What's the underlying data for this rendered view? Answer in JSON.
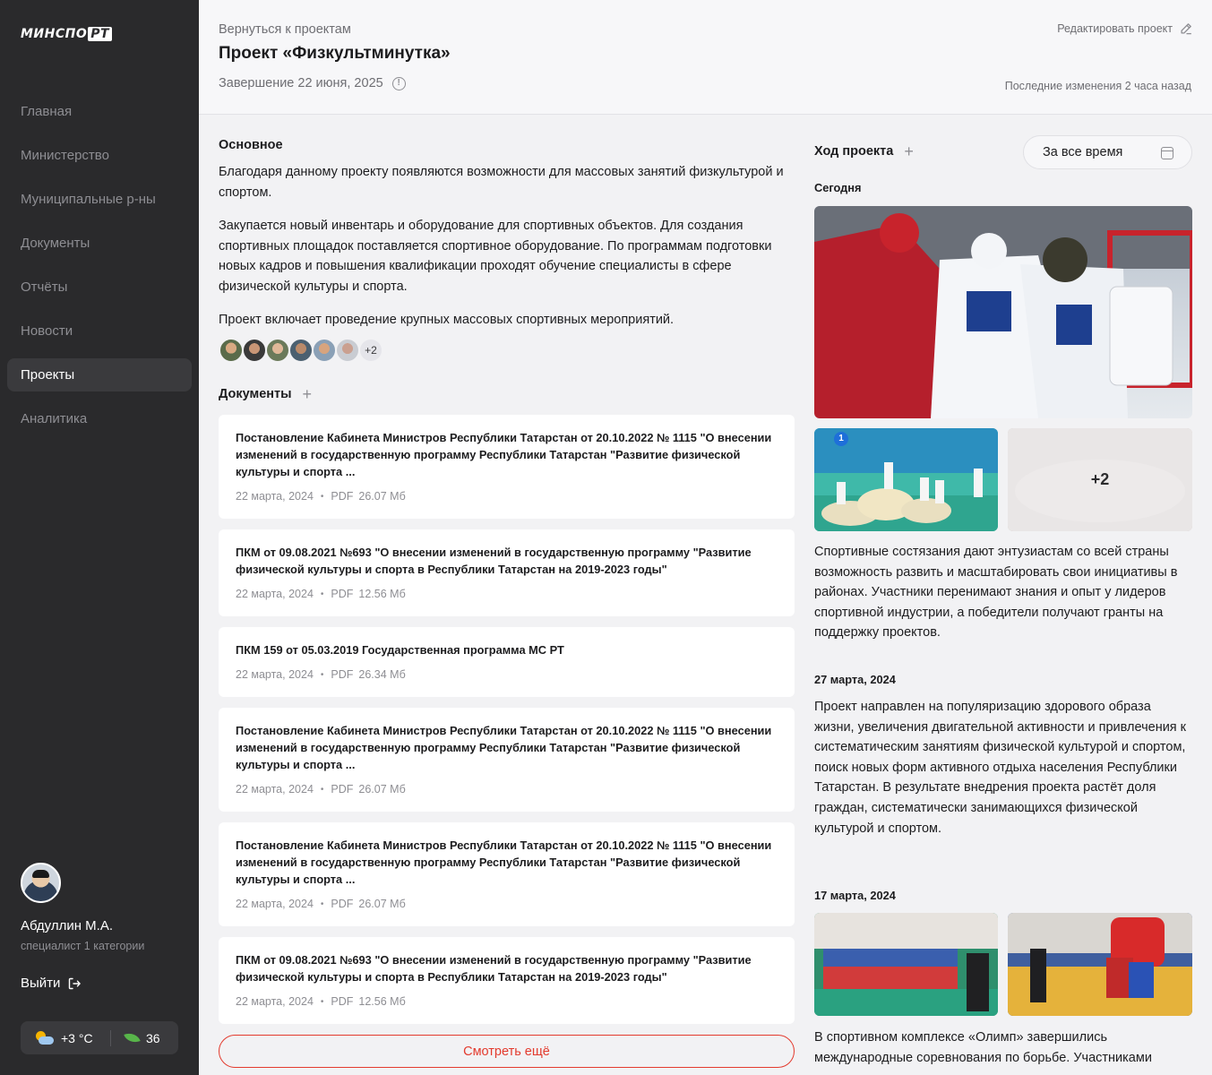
{
  "sidebar": {
    "logo": {
      "left": "МИНСПО",
      "boxed": "РТ"
    },
    "nav": [
      {
        "label": "Главная",
        "active": false
      },
      {
        "label": "Министерство",
        "active": false
      },
      {
        "label": "Муниципальные р-ны",
        "active": false
      },
      {
        "label": "Документы",
        "active": false
      },
      {
        "label": "Отчёты",
        "active": false
      },
      {
        "label": "Новости",
        "active": false
      },
      {
        "label": "Проекты",
        "active": true
      },
      {
        "label": "Аналитика",
        "active": false
      }
    ],
    "user": {
      "name": "Абдуллин М.А.",
      "role": "специалист 1 категории",
      "logout": "Выйти"
    },
    "widget": {
      "temperature": "+3 °C",
      "eco_value": "36"
    }
  },
  "header": {
    "back_link": "Вернуться к проектам",
    "title": "Проект «Физкультминутка»",
    "deadline": "Завершение 22 июня, 2025",
    "edit_link": "Редактировать проект",
    "last_change": "Последние изменения 2 часа назад"
  },
  "main": {
    "overview_heading": "Основное",
    "paragraphs": [
      "Благодаря данному проекту появляются возможности для массовых занятий физкультурой и спортом.",
      "Закупается новый инвентарь и оборудование для спортивных объектов. Для создания спортивных площадок поставляется спортивное оборудование. По программам подготовки новых кадров и повышения квалификации проходят обучение специалисты в сфере физической культуры и спорта.",
      "Проект включает проведение крупных массовых спортивных мероприятий."
    ],
    "participants_more": "+2",
    "documents_heading": "Документы",
    "documents": [
      {
        "title": "Постановление Кабинета Министров Республики Татарстан от 20.10.2022 № 1115 \"О внесении изменений в государственную программу Республики Татарстан \"Развитие физической культуры и спорта ...",
        "date": "22 марта, 2024",
        "type": "PDF",
        "size": "26.07 Мб"
      },
      {
        "title": "ПКМ от 09.08.2021 №693 \"О внесении изменений в государственную программу \"Развитие физической культуры и спорта в Республики Татарстан на 2019-2023 годы\"",
        "date": "22 марта, 2024",
        "type": "PDF",
        "size": "12.56 Мб"
      },
      {
        "title": "ПКМ 159 от 05.03.2019 Государственная программа МС РТ",
        "date": "22 марта, 2024",
        "type": "PDF",
        "size": "26.34 Мб"
      },
      {
        "title": "Постановление Кабинета Министров Республики Татарстан от 20.10.2022 № 1115 \"О внесении изменений в государственную программу Республики Татарстан \"Развитие физической культуры и спорта ...",
        "date": "22 марта, 2024",
        "type": "PDF",
        "size": "26.07 Мб"
      },
      {
        "title": "Постановление Кабинета Министров Республики Татарстан от 20.10.2022 № 1115 \"О внесении изменений в государственную программу Республики Татарстан \"Развитие физической культуры и спорта ...",
        "date": "22 марта, 2024",
        "type": "PDF",
        "size": "26.07 Мб"
      },
      {
        "title": "ПКМ от 09.08.2021 №693 \"О внесении изменений в государственную программу \"Развитие физической культуры и спорта в Республики Татарстан на 2019-2023 годы\"",
        "date": "22 марта, 2024",
        "type": "PDF",
        "size": "12.56 Мб"
      }
    ],
    "more_button": "Смотреть ещё"
  },
  "progress": {
    "heading": "Ход проекта",
    "period": "За все время",
    "entries": [
      {
        "date": "Сегодня",
        "photo_badge": "1",
        "photo_more": "+2",
        "text": "Спортивные состязания дают энтузиастам со всей страны возможность развить и масштабировать свои инициативы в районах. Участники перенимают знания и опыт у лидеров спортивной индустрии, а победители получают гранты на поддержку проектов."
      },
      {
        "date": "27 марта, 2024",
        "text": "Проект направлен на популяризацию здорового образа жизни, увеличения двигательной активности и привлечения к систематическим занятиям физической культурой и спортом, поиск новых форм активного отдыха населения Республики Татарстан. В результате внедрения проекта растёт доля граждан, систематически занимающихся физической культурой и спортом."
      },
      {
        "date": "17 марта, 2024",
        "text": "В спортивном комплексе «Олимп» завершились международные соревнования по борьбе. Участниками"
      }
    ]
  },
  "colors": {
    "accent": "#e33b2e",
    "sidebar_bg": "#2a2a2c",
    "content_bg": "#f2f2f4"
  },
  "icons": [
    "edit-icon",
    "info-icon",
    "plus-icon",
    "calendar-icon",
    "logout-icon",
    "weather-icon",
    "leaf-icon"
  ]
}
